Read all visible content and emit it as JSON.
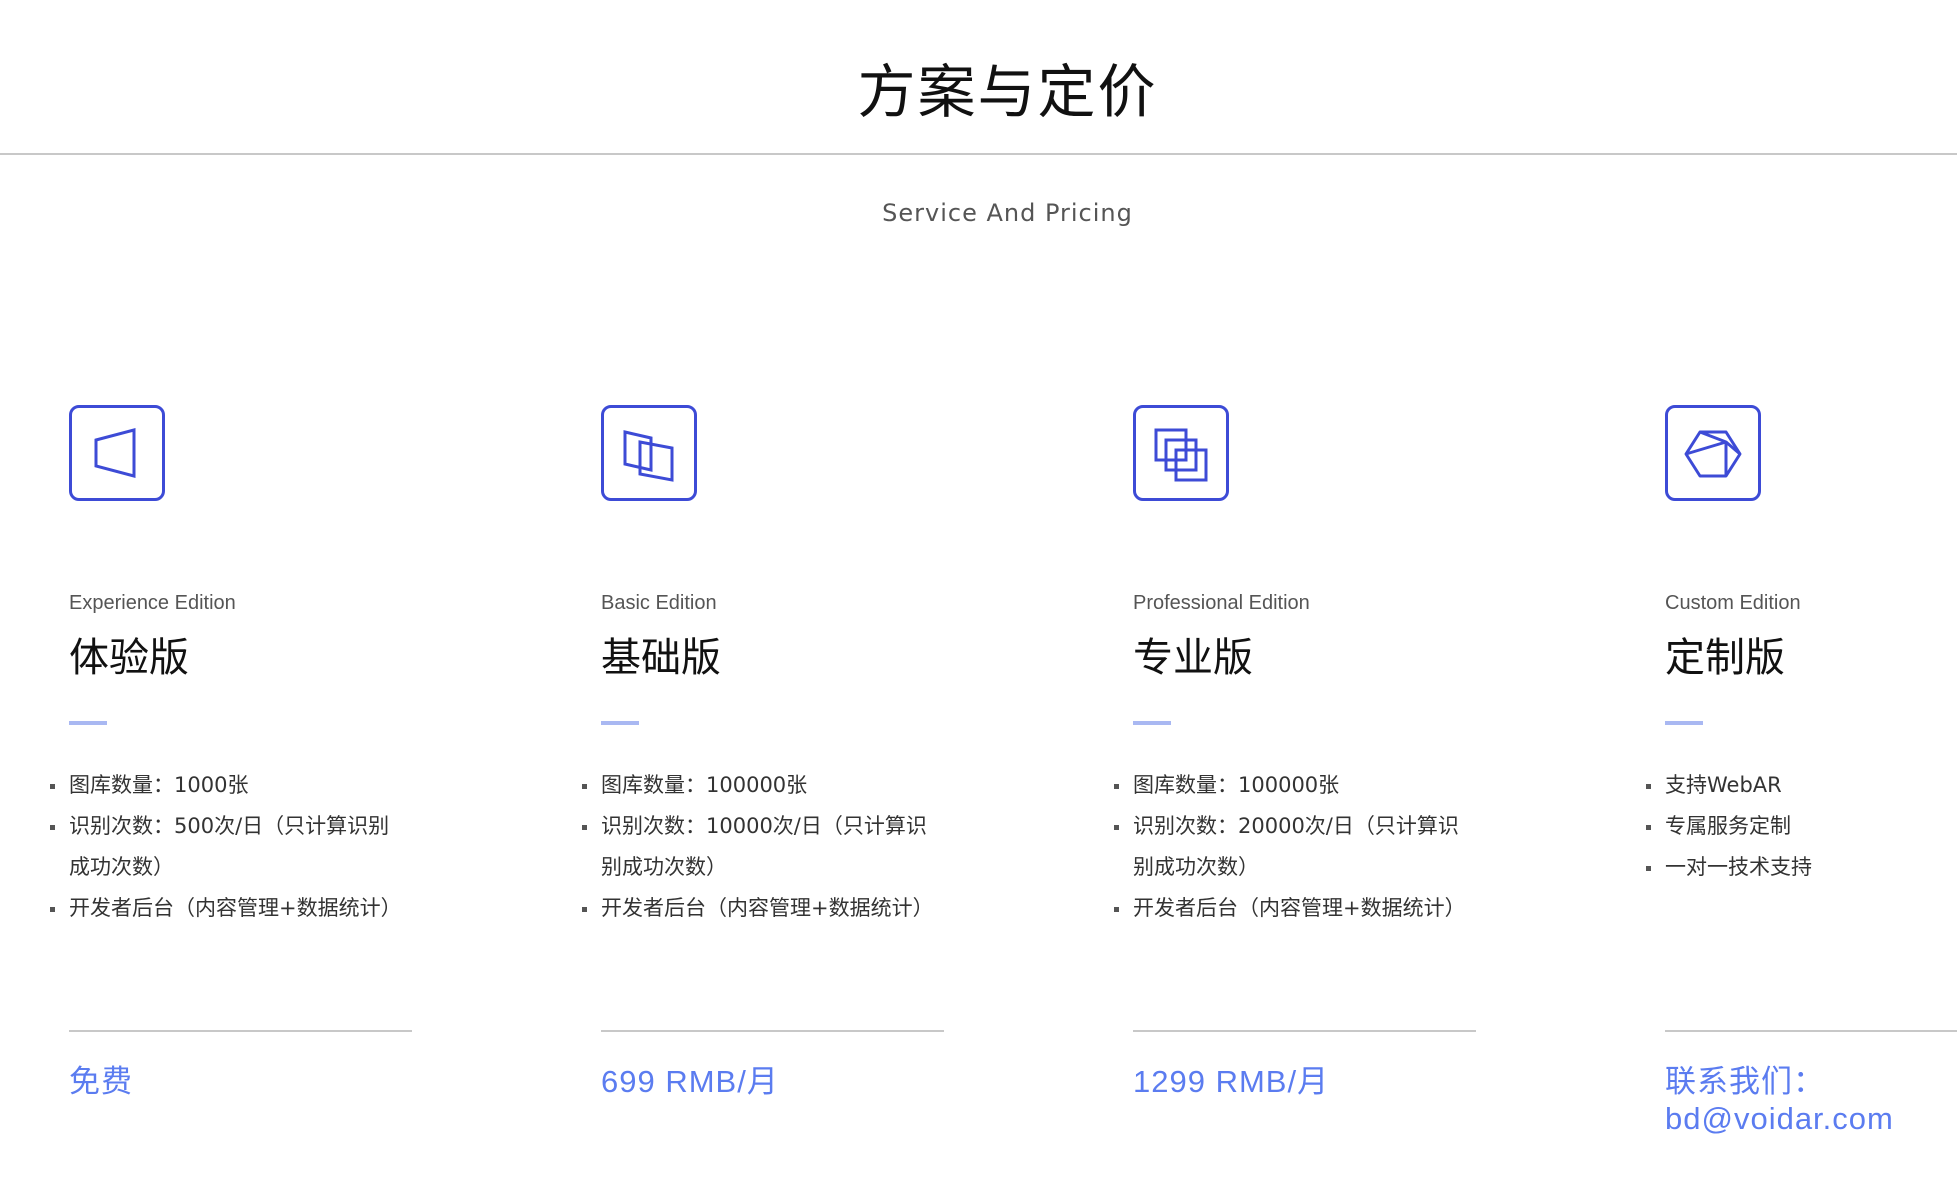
{
  "header": {
    "title": "方案与定价",
    "subtitle": "Service And Pricing"
  },
  "colors": {
    "accent": "#3d4bd6",
    "price": "#5b7cf0",
    "bar": "#a9b8f2"
  },
  "plans": [
    {
      "icon": "single-frame-icon",
      "edition_en": "Experience Edition",
      "edition_cn": "体验版",
      "features": [
        "图库数量：1000张",
        "识别次数：500次/日（只计算识别成功次数）",
        "开发者后台（内容管理+数据统计）"
      ],
      "price": "免费"
    },
    {
      "icon": "double-frame-icon",
      "edition_en": "Basic Edition",
      "edition_cn": "基础版",
      "features": [
        "图库数量：100000张",
        "识别次数：10000次/日（只计算识别成功次数）",
        "开发者后台（内容管理+数据统计）"
      ],
      "price": "699 RMB/月"
    },
    {
      "icon": "triple-frame-icon",
      "edition_en": "Professional Edition",
      "edition_cn": "专业版",
      "features": [
        "图库数量：100000张",
        "识别次数：20000次/日（只计算识别成功次数）",
        "开发者后台（内容管理+数据统计）"
      ],
      "price": "1299 RMB/月"
    },
    {
      "icon": "cube-icon",
      "edition_en": "Custom Edition",
      "edition_cn": "定制版",
      "features": [
        "支持WebAR",
        "专属服务定制",
        "一对一技术支持"
      ],
      "price_line1": "联系我们：",
      "price_line2": "bd@voidar.com"
    }
  ]
}
